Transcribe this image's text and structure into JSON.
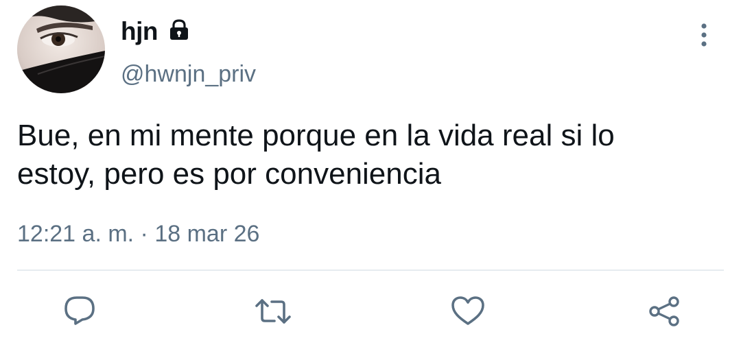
{
  "tweet": {
    "display_name": "hjn",
    "username": "@hwnjn_priv",
    "text": "Bue, en mi mente porque en la vida real si lo\nestoy, pero es por conveniencia",
    "time": "12:21 a. m.",
    "separator": " · ",
    "date": "18 mar 26"
  },
  "icons": {
    "lock": "lock-icon",
    "more": "more-vertical-icon",
    "reply": "reply-icon",
    "retweet": "retweet-icon",
    "like": "heart-icon",
    "share": "share-icon"
  },
  "colors": {
    "text": "#0f1419",
    "secondary": "#5b7083",
    "divider": "#e6ecf0",
    "icon": "#5b7083"
  }
}
